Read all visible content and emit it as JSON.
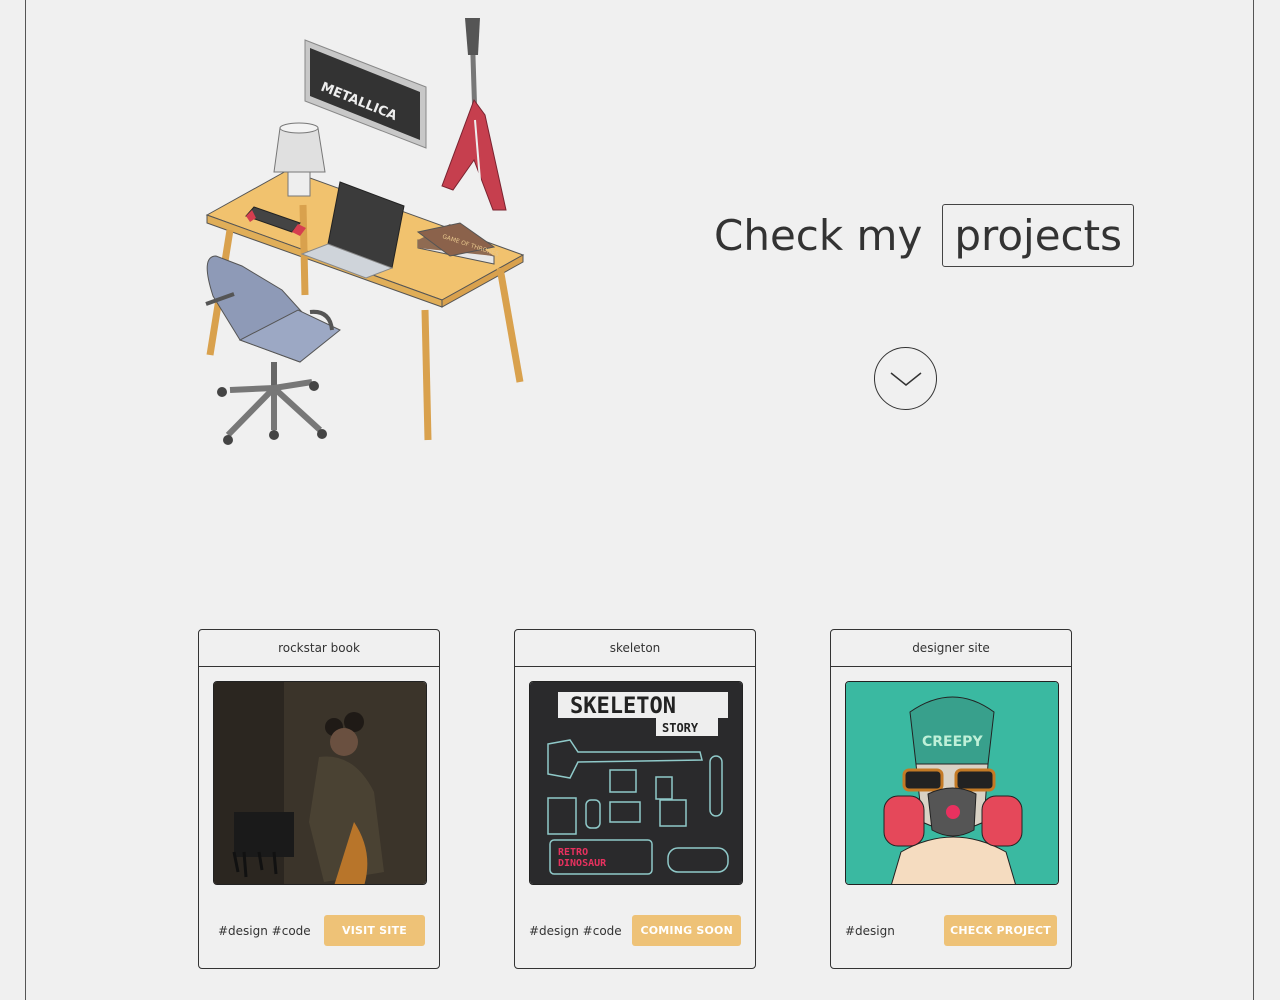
{
  "hero": {
    "headline_prefix": "Check my",
    "headline_highlight": "projects",
    "poster_text": "METALLICA",
    "book_text": "GAME OF THRONES"
  },
  "projects": [
    {
      "title": "rockstar book",
      "tags": "#design #code",
      "cta": "VISIT SITE"
    },
    {
      "title": "skeleton",
      "tags": "#design #code",
      "cta": "COMING SOON",
      "art_title": "SKELETON",
      "art_subtitle": "STORY",
      "art_badge": "RETRO\nDINOSAUR"
    },
    {
      "title": "designer site",
      "tags": "#design",
      "cta": "CHECK PROJECT",
      "art_text": "CREEPY"
    }
  ],
  "colors": {
    "background": "#f0f0f0",
    "accent": "#eec277",
    "desk": "#f1c26e",
    "chair": "#8e9ab7",
    "guitar": "#c63f4e",
    "teal": "#3ab9a1",
    "pink": "#e8315f"
  }
}
